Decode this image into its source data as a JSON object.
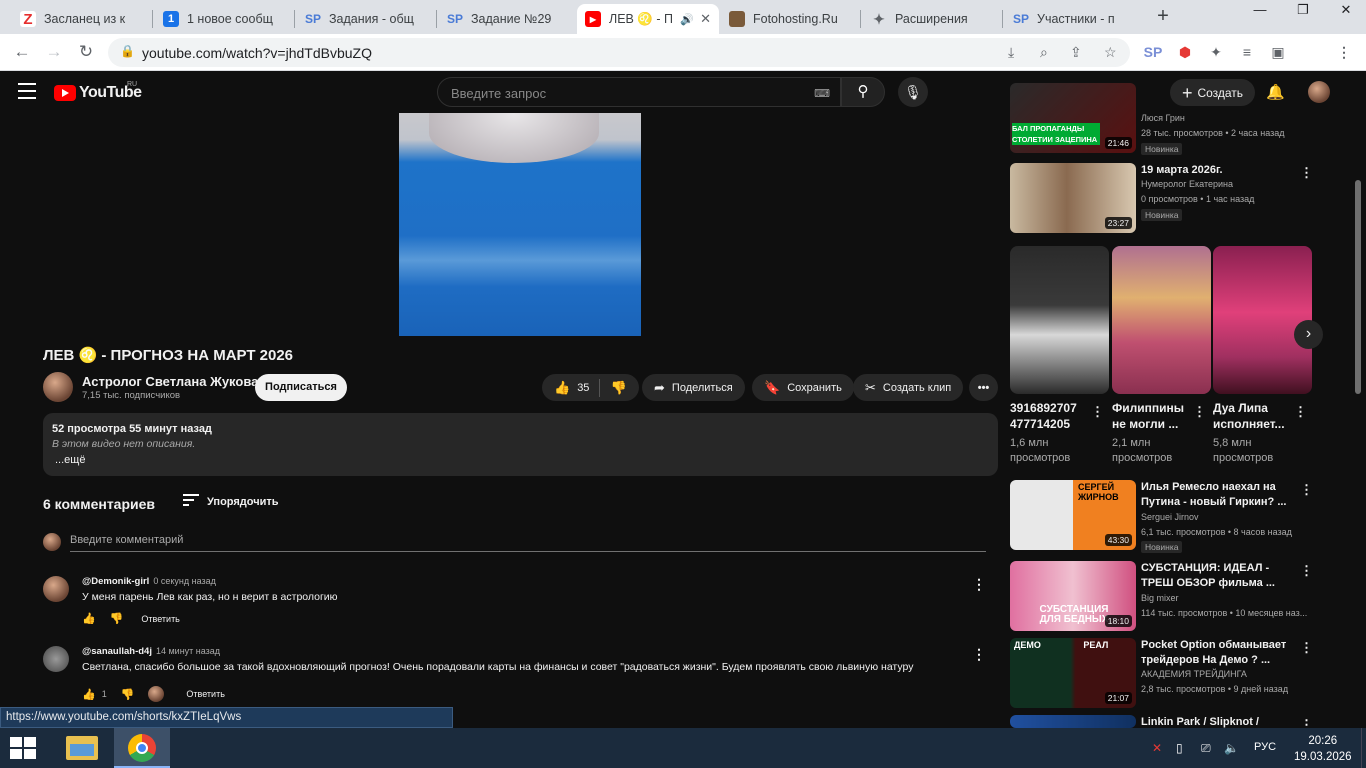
{
  "browser": {
    "tabs": [
      {
        "title": "Засланец из к",
        "favicon_color": "#e62e2e",
        "favicon_text": "Z"
      },
      {
        "title": "1 новое сообщ",
        "favicon_color": "#1a73e8",
        "favicon_text": "1"
      },
      {
        "title": "Задания - общ",
        "favicon_color": "#c7d7ff",
        "favicon_text": "SP"
      },
      {
        "title": "Задание №29",
        "favicon_color": "#c7d7ff",
        "favicon_text": "SP"
      },
      {
        "title": "ЛЕВ ♌ - П",
        "favicon_color": "#ff0000",
        "favicon_text": "▶"
      },
      {
        "title": "Fotohosting.Ru",
        "favicon_color": "#7a5a3a",
        "favicon_text": ""
      },
      {
        "title": "Расширения",
        "favicon_color": "#5f6368",
        "favicon_text": "✦"
      },
      {
        "title": "Участники - п",
        "favicon_color": "#c7d7ff",
        "favicon_text": "SP"
      }
    ],
    "new_tab": "+",
    "url": "youtube.com/watch?v=jhdTdBvbuZQ",
    "status_url": "https://www.youtube.com/shorts/kxZTIeLqVws"
  },
  "youtube": {
    "logo": "YouTube",
    "region": "RU",
    "search_placeholder": "Введите запрос",
    "create": "Создать",
    "video_title": "ЛЕВ ♌ - ПРОГНОЗ НА МАРТ 2026",
    "channel": "Астролог Светлана Жукова",
    "subscribers": "7,15 тыс. подписчиков",
    "subscribe": "Подписаться",
    "likes": "35",
    "share": "Поделиться",
    "save": "Сохранить",
    "clip": "Создать клип",
    "views_line": "52 просмотра  55 минут назад",
    "no_description": "В этом видео нет описания.",
    "more": "...ещё",
    "comments_title": "6 комментариев",
    "sort": "Упорядочить",
    "comment_placeholder": "Введите комментарий",
    "comments": [
      {
        "author": "@Demonik-girl",
        "time": "0 секунд назад",
        "text": "У меня парень Лев  как раз, но н верит в астрологию",
        "likes": "",
        "reply": "Ответить"
      },
      {
        "author": "@sanaullah-d4j",
        "time": "14 минут назад",
        "text": "Светлана, спасибо большое за такой вдохновляющий прогноз! Очень порадовали карты на финансы и совет \"радоваться жизни\". Будем проявлять свою львиную натуру",
        "likes": "1",
        "reply": "Ответить"
      }
    ]
  },
  "sidebar": {
    "items": [
      {
        "title": "",
        "thumb_text": "БАЛ ПРОПАГАНДЫ СТОЛЕТИИ ЗАЦЕПИНА",
        "channel": "Люся Грин",
        "meta": "28 тыс. просмотров • 2 часа назад",
        "badge": "Новинка",
        "duration": "21:46"
      },
      {
        "title": "19 марта 2026г.",
        "channel": "Нумеролог Екатерина",
        "meta": "0 просмотров • 1 час назад",
        "badge": "Новинка",
        "duration": "23:27"
      },
      {
        "title": "Илья Ремесло наехал на Путина - новый Гиркин? ...",
        "thumb_text": "СЕРГЕЙ ЖИРНОВ",
        "channel": "Serguei Jirnov",
        "meta": "6,1 тыс. просмотров • 8 часов назад",
        "badge": "Новинка",
        "duration": "43:30"
      },
      {
        "title": "СУБСТАНЦИЯ: ИДЕАЛ - ТРЕШ ОБЗОР фильма ...",
        "thumb_text": "СУБСТАНЦИЯ ДЛЯ БЕДНЫХ",
        "channel": "Big mixer",
        "meta": "114 тыс. просмотров • 10 месяцев наз...",
        "badge": "",
        "duration": "18:10"
      },
      {
        "title": "Pocket Option обманывает трейдеров На Демо ? ...",
        "thumb_text": "ДЕМО РЕАЛ",
        "channel": "АКАДЕМИЯ ТРЕЙДИНГА",
        "meta": "2,8 тыс. просмотров • 9 дней назад",
        "badge": "",
        "duration": "21:07"
      },
      {
        "title": "Linkin Park / Slipknot /",
        "channel": "",
        "meta": "",
        "badge": "",
        "duration": ""
      }
    ],
    "shorts": [
      {
        "title": "3916892707 477714205",
        "views": "1,6 млн просмотров"
      },
      {
        "title": "Филиппины не могли ...",
        "views": "2,1 млн просмотров"
      },
      {
        "title": "Дуа Липа исполняет...",
        "views": "5,8 млн просмотров"
      }
    ]
  },
  "taskbar": {
    "language": "РУС",
    "time": "20:26",
    "date": "19.03.2026"
  }
}
